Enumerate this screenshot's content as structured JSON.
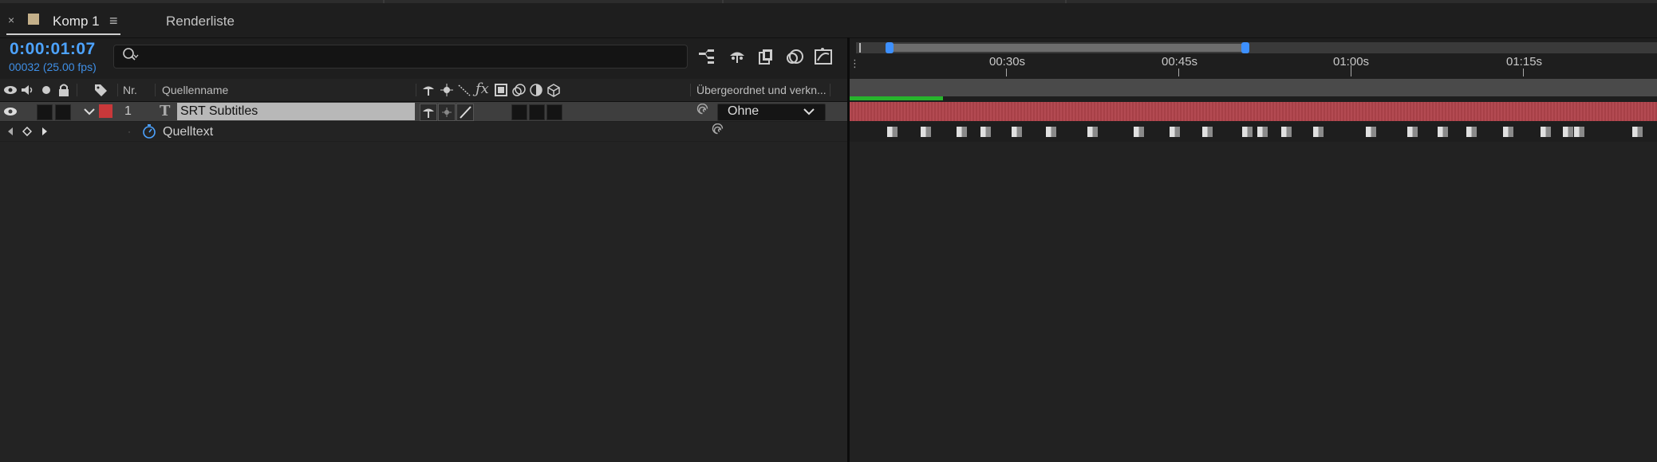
{
  "tabs": {
    "close_glyph": "×",
    "comp_tab": "Komp 1",
    "menu_glyph": "≡",
    "render_tab": "Renderliste"
  },
  "header": {
    "timecode": "0:00:01:07",
    "frames_fps": "00032 (25.00 fps)",
    "search_placeholder": ""
  },
  "ruler": {
    "labels": [
      "00:30s",
      "00:45s",
      "01:00s",
      "01:15s"
    ]
  },
  "columns": {
    "nr": "Nr.",
    "source_name": "Quellenname",
    "parent": "Übergeordnet und verkn..."
  },
  "layer": {
    "number": "1",
    "type_glyph": "T",
    "name": "SRT Subtitles",
    "parent_value": "Ohne",
    "label_color": "#c9383a",
    "bar_color": "#b0434b"
  },
  "property": {
    "name": "Quelltext"
  },
  "colors": {
    "accent": "#4da3ff",
    "work_area_green": "#27b52c"
  }
}
